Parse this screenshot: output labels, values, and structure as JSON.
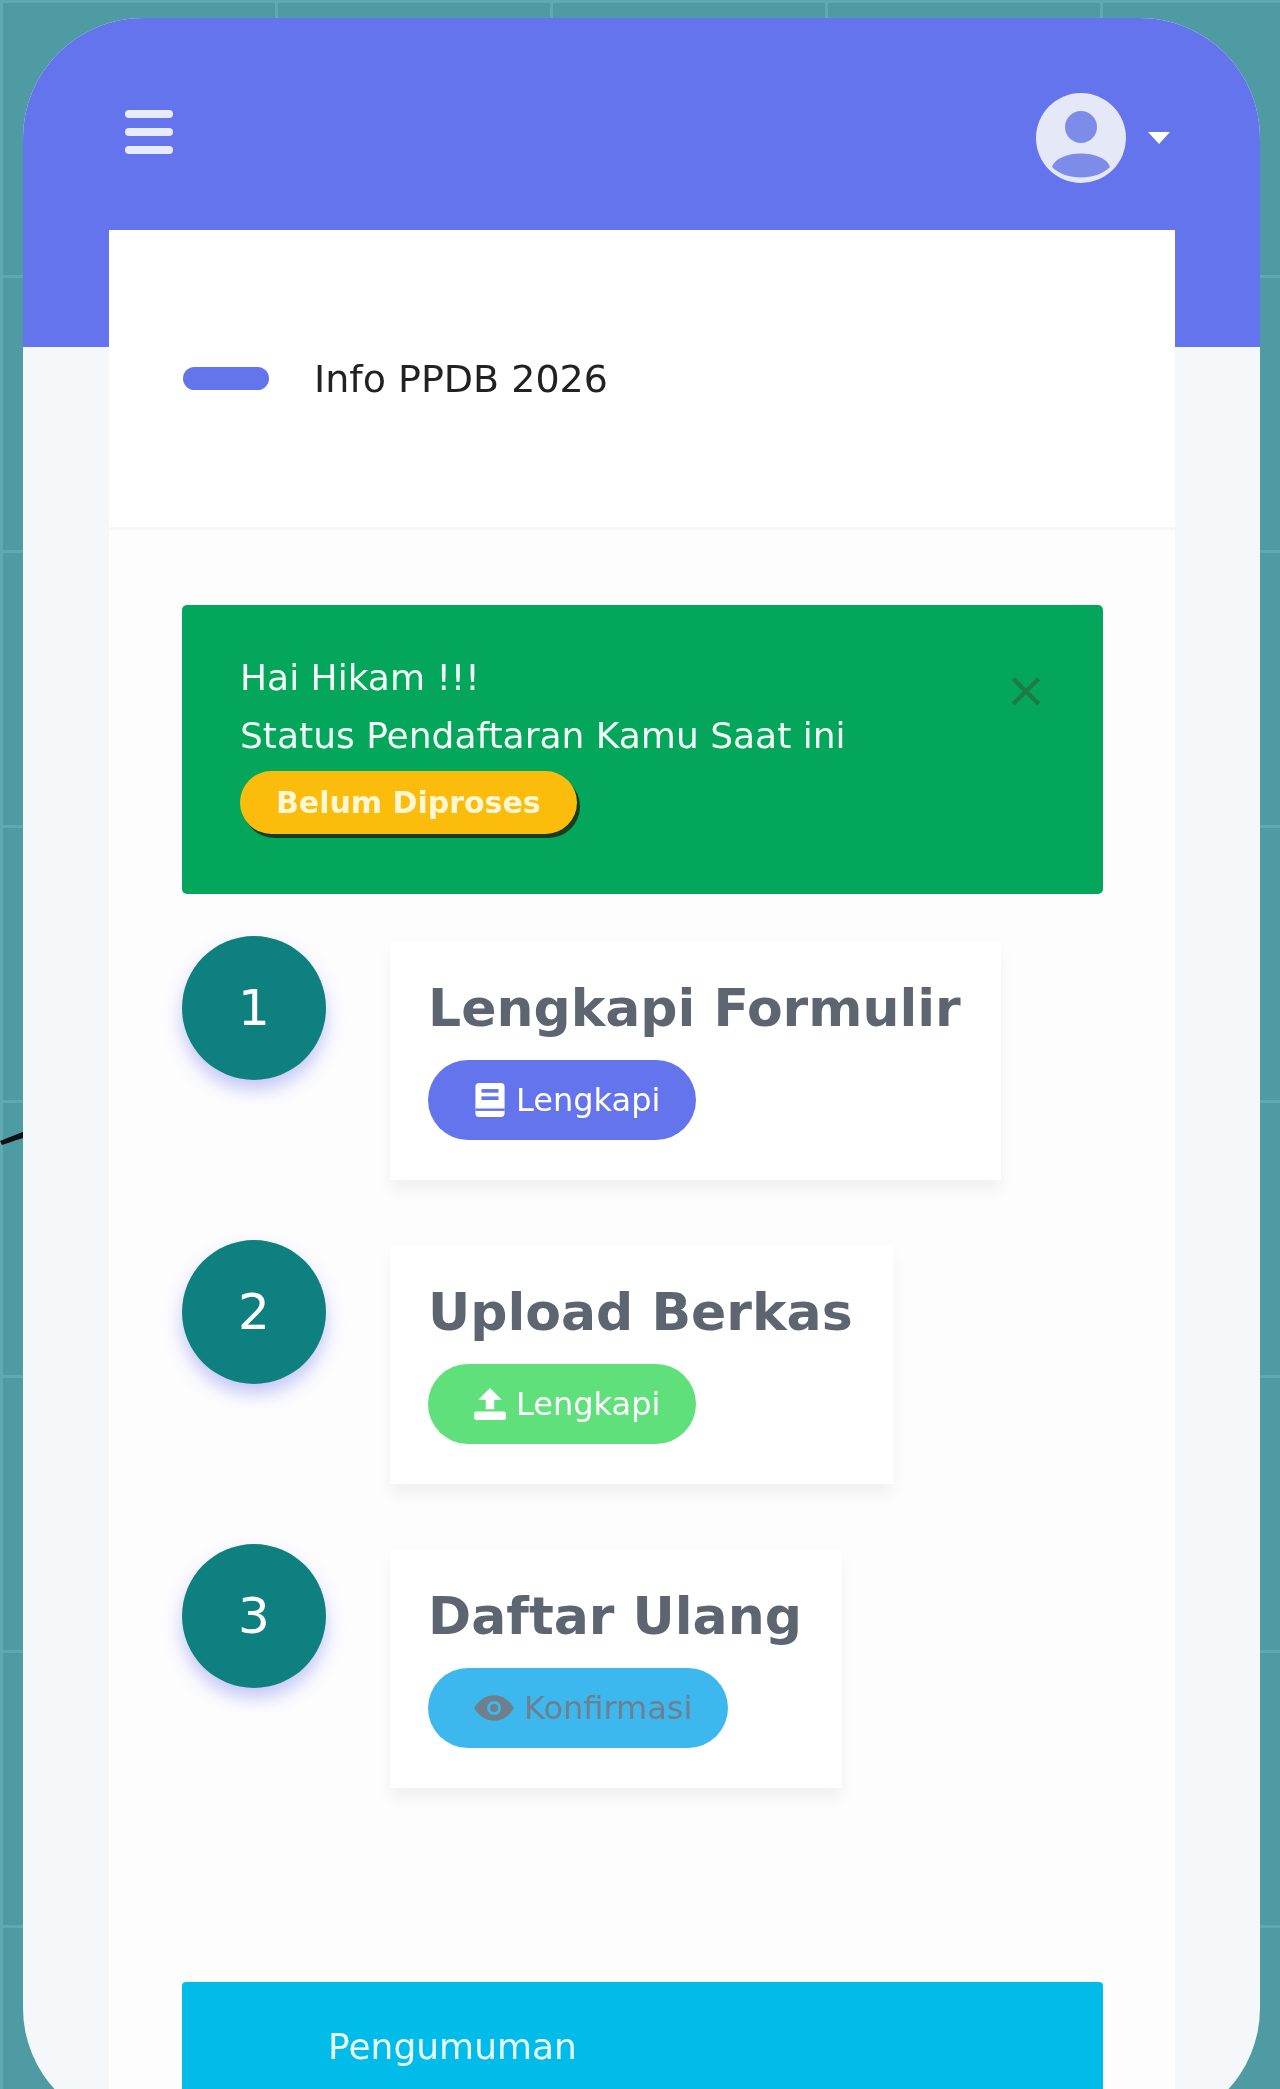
{
  "header": {
    "title": "Info PPDB 2026"
  },
  "alert": {
    "greeting": "Hai Hikam !!!",
    "message": "Status Pendaftaran Kamu Saat ini",
    "status": "Belum Diproses",
    "close": "×"
  },
  "steps": [
    {
      "number": "1",
      "title": "Lengkapi Formulir",
      "button": "Lengkapi",
      "kind": "form",
      "color": "#6474ec",
      "disabled": false
    },
    {
      "number": "2",
      "title": "Upload Berkas",
      "button": "Lengkapi",
      "kind": "upload",
      "color": "#5fe07a",
      "disabled": false
    },
    {
      "number": "3",
      "title": "Daftar Ulang",
      "button": "Konfirmasi",
      "kind": "confirm",
      "color": "#3db8ef",
      "disabled": true
    }
  ],
  "announcement": {
    "title": "Pengumuman"
  }
}
